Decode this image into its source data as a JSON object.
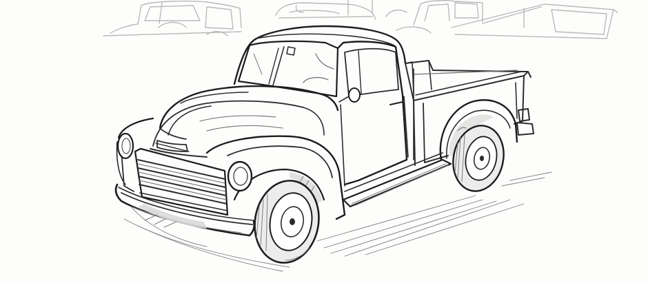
{
  "scene": {
    "subject": "pickup-truck-sketch",
    "style": "pencil-line-drawing",
    "palette": {
      "paper": "#fdfdfc",
      "ink": "#2b2b2b",
      "ghost_ink": "#b9b9b9",
      "shade": "#d9d9d9"
    }
  },
  "background_sketches": [
    {
      "subject": "truck-cab-sketch"
    },
    {
      "subject": "truck-front-sketch"
    },
    {
      "subject": "truck-cab-bed-sketch"
    }
  ]
}
